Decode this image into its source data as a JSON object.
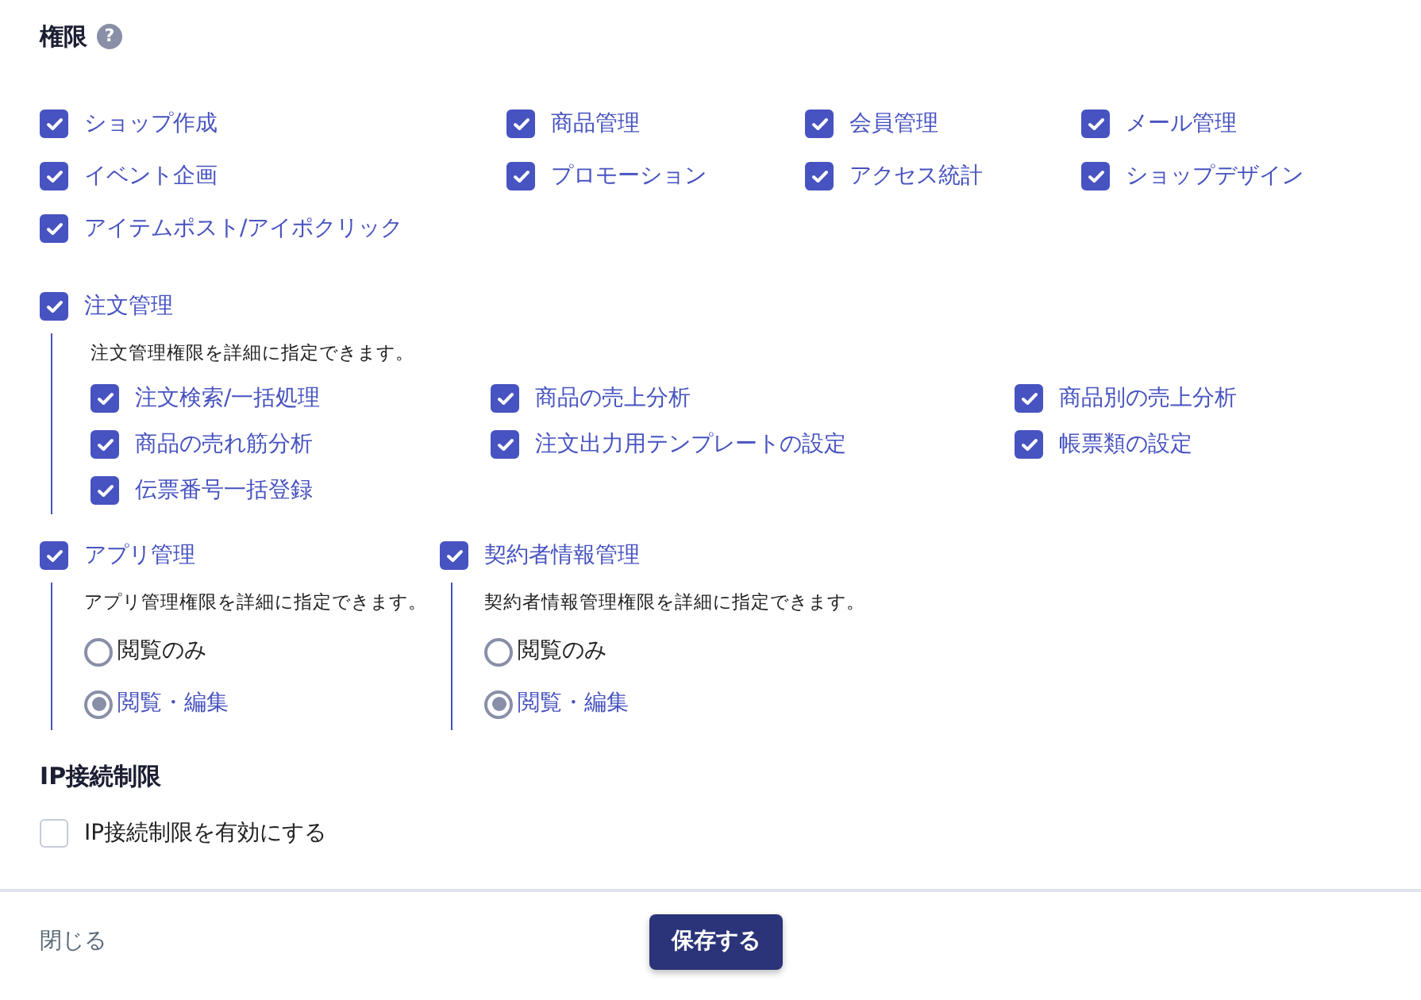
{
  "title": "権限",
  "help_icon": "?",
  "permissions": [
    {
      "label": "ショップ作成",
      "checked": true
    },
    {
      "label": "商品管理",
      "checked": true
    },
    {
      "label": "会員管理",
      "checked": true
    },
    {
      "label": "メール管理",
      "checked": true
    },
    {
      "label": "イベント企画",
      "checked": true
    },
    {
      "label": "プロモーション",
      "checked": true
    },
    {
      "label": "アクセス統計",
      "checked": true
    },
    {
      "label": "ショップデザイン",
      "checked": true
    },
    {
      "label": "アイテムポスト/アイポクリック",
      "checked": true
    }
  ],
  "order": {
    "label": "注文管理",
    "checked": true,
    "description": "注文管理権限を詳細に指定できます。",
    "items": [
      {
        "label": "注文検索/一括処理",
        "checked": true
      },
      {
        "label": "商品の売上分析",
        "checked": true
      },
      {
        "label": "商品別の売上分析",
        "checked": true
      },
      {
        "label": "商品の売れ筋分析",
        "checked": true
      },
      {
        "label": "注文出力用テンプレートの設定",
        "checked": true
      },
      {
        "label": "帳票類の設定",
        "checked": true
      },
      {
        "label": "伝票番号一括登録",
        "checked": true
      }
    ]
  },
  "detail_groups": [
    {
      "label": "アプリ管理",
      "checked": true,
      "description": "アプリ管理権限を詳細に指定できます。",
      "options": [
        {
          "label": "閲覧のみ",
          "selected": false
        },
        {
          "label": "閲覧・編集",
          "selected": true
        }
      ]
    },
    {
      "label": "契約者情報管理",
      "checked": true,
      "description": "契約者情報管理権限を詳細に指定できます。",
      "options": [
        {
          "label": "閲覧のみ",
          "selected": false
        },
        {
          "label": "閲覧・編集",
          "selected": true
        }
      ]
    }
  ],
  "ip": {
    "heading": "IP接続制限",
    "option": {
      "label": "IP接続制限を有効にする",
      "checked": false
    }
  },
  "footer": {
    "close": "閉じる",
    "save": "保存する"
  }
}
